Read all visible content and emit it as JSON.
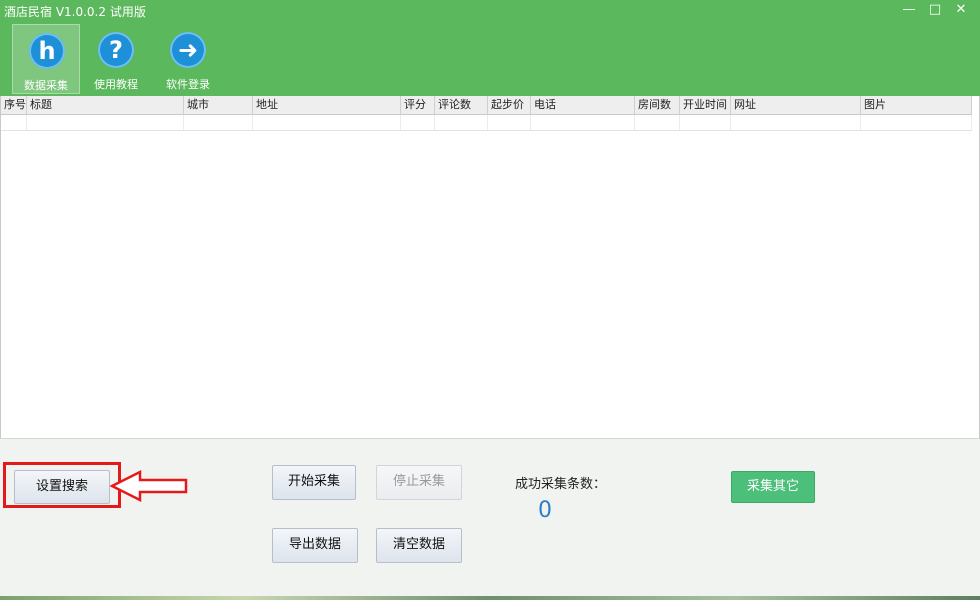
{
  "app": {
    "title": "酒店民宿 V1.0.0.2 试用版"
  },
  "window_controls": {
    "minimize": "—",
    "maximize": "□",
    "close": "✕"
  },
  "toolbar": [
    {
      "label": "数据采集",
      "icon": "h",
      "icon_name": "hotel-h-icon"
    },
    {
      "label": "使用教程",
      "icon": "?",
      "icon_name": "help-question-icon"
    },
    {
      "label": "软件登录",
      "icon": "➜",
      "icon_name": "login-arrow-icon"
    }
  ],
  "table": {
    "columns": [
      "序号",
      "标题",
      "城市",
      "地址",
      "评分",
      "评论数",
      "起步价",
      "电话",
      "房间数",
      "开业时间",
      "网址",
      "图片"
    ],
    "rows": []
  },
  "controls": {
    "settings_search": "设置搜索",
    "start_collect": "开始采集",
    "stop_collect": "停止采集",
    "export_data": "导出数据",
    "clear_data": "清空数据",
    "collect_other": "采集其它",
    "success_label": "成功采集条数：",
    "success_count": "0"
  },
  "colors": {
    "brand_green": "#5cb85c",
    "accent_button": "#4cbf7a",
    "count_blue": "#2c7fc4",
    "annotation_red": "#e41a1a"
  }
}
